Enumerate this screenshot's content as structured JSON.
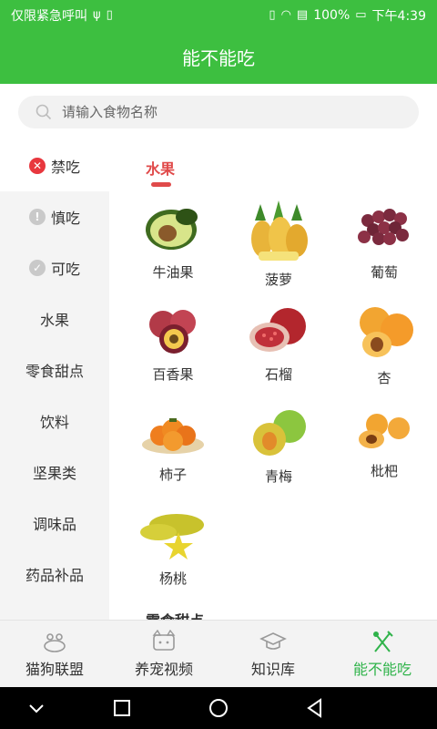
{
  "status_bar": {
    "left_text": "仅限紧急呼叫",
    "battery": "100%",
    "time": "下午4:39"
  },
  "header": {
    "title": "能不能吃"
  },
  "search": {
    "placeholder": "请输入食物名称"
  },
  "sidebar": {
    "items": [
      {
        "label": "禁吃",
        "icon": "forbidden-icon"
      },
      {
        "label": "慎吃",
        "icon": "caution-icon"
      },
      {
        "label": "可吃",
        "icon": "check-icon"
      },
      {
        "label": "水果"
      },
      {
        "label": "零食甜点"
      },
      {
        "label": "饮料"
      },
      {
        "label": "坚果类"
      },
      {
        "label": "调味品"
      },
      {
        "label": "药品补品"
      }
    ]
  },
  "content": {
    "category_title": "水果",
    "items": [
      {
        "name": "牛油果",
        "icon": "avocado-icon"
      },
      {
        "name": "菠萝",
        "icon": "pineapple-icon"
      },
      {
        "name": "葡萄",
        "icon": "grape-icon"
      },
      {
        "name": "百香果",
        "icon": "passionfruit-icon"
      },
      {
        "name": "石榴",
        "icon": "pomegranate-icon"
      },
      {
        "name": "杏",
        "icon": "apricot-icon"
      },
      {
        "name": "柿子",
        "icon": "persimmon-icon"
      },
      {
        "name": "青梅",
        "icon": "greenplum-icon"
      },
      {
        "name": "枇杷",
        "icon": "loquat-icon"
      },
      {
        "name": "杨桃",
        "icon": "starfruit-icon"
      }
    ],
    "next_category_title": "零食甜点"
  },
  "bottom_nav": {
    "items": [
      {
        "label": "猫狗联盟",
        "icon": "pets-icon"
      },
      {
        "label": "养宠视频",
        "icon": "video-icon"
      },
      {
        "label": "知识库",
        "icon": "graduation-cap-icon"
      },
      {
        "label": "能不能吃",
        "icon": "fork-knife-icon"
      }
    ],
    "active_color": "#2fb34a"
  },
  "colors": {
    "brand_green": "#3dbf40",
    "accent_red": "#e04a4a"
  }
}
